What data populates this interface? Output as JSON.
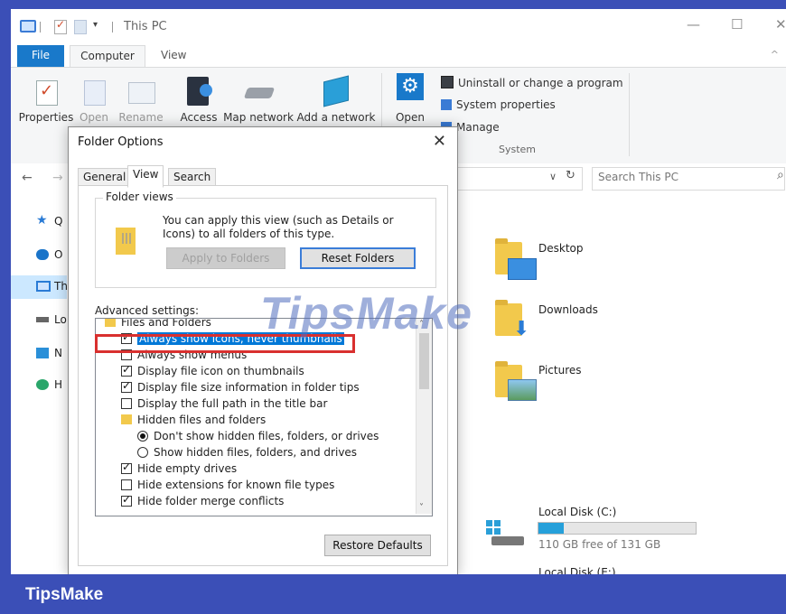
{
  "window": {
    "title": "This PC",
    "quick_access": [
      "computer-icon",
      "properties-check-icon",
      "new-folder-icon",
      "customize-down-icon"
    ],
    "controls": {
      "minimize": "—",
      "maximize": "☐",
      "close": "✕"
    }
  },
  "ribbon": {
    "tabs": [
      {
        "label": "File",
        "active": false
      },
      {
        "label": "Computer",
        "active": true
      },
      {
        "label": "View",
        "active": false
      }
    ],
    "collapse_glyph": "^",
    "buttons": [
      {
        "label": "Properties",
        "enabled": true,
        "icon": "properties-icon"
      },
      {
        "label": "Open",
        "enabled": false,
        "icon": "open-icon"
      },
      {
        "label": "Rename",
        "enabled": false,
        "icon": "rename-icon"
      },
      {
        "label": "Access",
        "enabled": true,
        "icon": "access-media-icon"
      },
      {
        "label": "Map network",
        "enabled": true,
        "icon": "map-network-drive-icon"
      },
      {
        "label": "Add a network",
        "enabled": true,
        "icon": "add-network-location-icon"
      },
      {
        "label": "Open",
        "enabled": true,
        "icon": "settings-gear-icon"
      }
    ],
    "system_group": {
      "items": [
        "Uninstall or change a program",
        "System properties",
        "Manage"
      ],
      "label": "System"
    }
  },
  "address_bar": {
    "back": "←",
    "forward": "→",
    "dropdown": "∨",
    "refresh": "↻",
    "search_placeholder": "Search This PC",
    "search_glyph": "⌕"
  },
  "nav_pane": {
    "items": [
      {
        "label": "Q",
        "icon": "star-icon",
        "selected": false
      },
      {
        "label": "O",
        "icon": "onedrive-cloud-icon",
        "selected": false
      },
      {
        "label": "Th",
        "icon": "this-pc-icon",
        "selected": true
      },
      {
        "label": "Lo",
        "icon": "local-drive-icon",
        "selected": false
      },
      {
        "label": "N",
        "icon": "network-icon",
        "selected": false
      },
      {
        "label": "H",
        "icon": "homegroup-icon",
        "selected": false
      }
    ]
  },
  "content": {
    "folders": [
      {
        "name": "Desktop",
        "icon": "desktop-folder-icon"
      },
      {
        "name": "Downloads",
        "icon": "downloads-folder-icon"
      },
      {
        "name": "Pictures",
        "icon": "pictures-folder-icon"
      }
    ],
    "drives": [
      {
        "name": "Local Disk (C:)",
        "free_text": "110 GB free of 131 GB",
        "used_fraction": 0.16
      },
      {
        "name": "Local Disk (E:)"
      }
    ]
  },
  "dialog": {
    "title": "Folder Options",
    "close_glyph": "✕",
    "tabs": [
      {
        "label": "General",
        "active": false
      },
      {
        "label": "View",
        "active": true
      },
      {
        "label": "Search",
        "active": false
      }
    ],
    "folder_views": {
      "title": "Folder views",
      "description": "You can apply this view (such as Details or Icons) to all folders of this type.",
      "apply_label": "Apply to Folders",
      "reset_label": "Reset Folders"
    },
    "advanced_label": "Advanced settings:",
    "settings": [
      {
        "type": "folder",
        "label": "Files and Folders",
        "indent": 0
      },
      {
        "type": "checkbox",
        "label": "Always show icons, never thumbnails",
        "checked": true,
        "selected": true,
        "indent": 1
      },
      {
        "type": "checkbox",
        "label": "Always show menus",
        "checked": false,
        "indent": 1
      },
      {
        "type": "checkbox",
        "label": "Display file icon on thumbnails",
        "checked": true,
        "indent": 1
      },
      {
        "type": "checkbox",
        "label": "Display file size information in folder tips",
        "checked": true,
        "indent": 1
      },
      {
        "type": "checkbox",
        "label": "Display the full path in the title bar",
        "checked": false,
        "indent": 1
      },
      {
        "type": "folder",
        "label": "Hidden files and folders",
        "indent": 1
      },
      {
        "type": "radio",
        "label": "Don't show hidden files, folders, or drives",
        "checked": true,
        "indent": 2
      },
      {
        "type": "radio",
        "label": "Show hidden files, folders, and drives",
        "checked": false,
        "indent": 2
      },
      {
        "type": "checkbox",
        "label": "Hide empty drives",
        "checked": true,
        "indent": 1
      },
      {
        "type": "checkbox",
        "label": "Hide extensions for known file types",
        "checked": false,
        "indent": 1
      },
      {
        "type": "checkbox",
        "label": "Hide folder merge conflicts",
        "checked": true,
        "indent": 1
      }
    ],
    "scroll_up": "˄",
    "scroll_down": "˅",
    "restore_label": "Restore Defaults"
  },
  "watermark": "TipsMake",
  "branding": "TipsMake"
}
